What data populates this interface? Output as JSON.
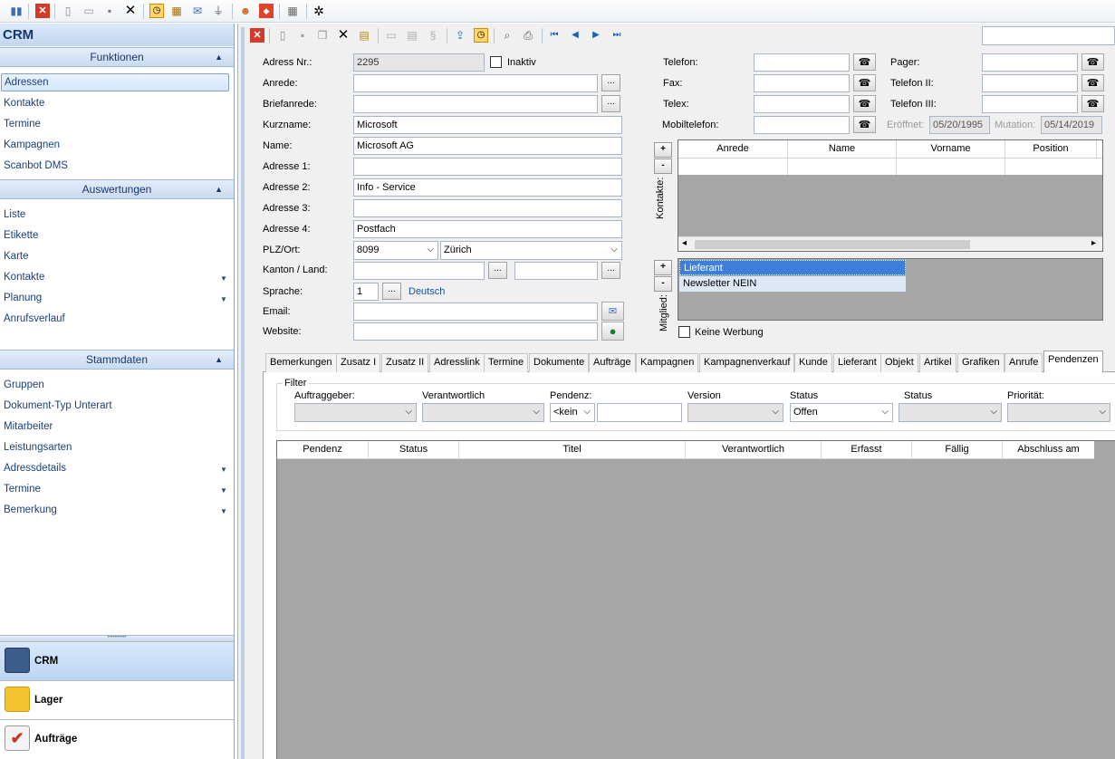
{
  "app_title": "CRM",
  "sidebar": {
    "funktionen_header": "Funktionen",
    "funktionen_items": [
      "Adressen",
      "Kontakte",
      "Termine",
      "Kampagnen",
      "Scanbot DMS"
    ],
    "auswertungen_header": "Auswertungen",
    "auswertungen_items": [
      "Liste",
      "Etikette",
      "Karte",
      "Kontakte",
      "Planung",
      "Anrufsverlauf"
    ],
    "stammdaten_header": "Stammdaten",
    "stammdaten_items": [
      "Gruppen",
      "Dokument-Typ Unterart",
      "Mitarbeiter",
      "Leistungsarten",
      "Adressdetails",
      "Termine",
      "Bemerkung"
    ],
    "modules": [
      "CRM",
      "Lager",
      "Aufträge"
    ]
  },
  "form": {
    "adress_nr_label": "Adress Nr.:",
    "adress_nr": "2295",
    "inaktiv_label": "Inaktiv",
    "anrede_label": "Anrede:",
    "briefanrede_label": "Briefanrede:",
    "kurzname_label": "Kurzname:",
    "kurzname": "Microsoft",
    "name_label": "Name:",
    "name": "Microsoft AG",
    "adresse1_label": "Adresse 1:",
    "adresse2_label": "Adresse 2:",
    "adresse2": "Info - Service",
    "adresse3_label": "Adresse 3:",
    "adresse4_label": "Adresse 4:",
    "adresse4": "Postfach",
    "plz_label": "PLZ/Ort:",
    "plz": "8099",
    "ort": "Zürich",
    "kanton_label": "Kanton / Land:",
    "sprache_label": "Sprache:",
    "sprache_code": "1",
    "sprache_name": "Deutsch",
    "email_label": "Email:",
    "website_label": "Website:",
    "telefon_label": "Telefon:",
    "fax_label": "Fax:",
    "telex_label": "Telex:",
    "mobil_label": "Mobiltelefon:",
    "pager_label": "Pager:",
    "telefon2_label": "Telefon II:",
    "telefon3_label": "Telefon III:",
    "eroeffnet_label": "Eröffnet:",
    "eroeffnet": "05/20/1995",
    "mutation_label": "Mutation:",
    "mutation": "05/14/2019",
    "kontakte_side_label": "Kontakte:",
    "mitglied_side_label": "Mitglied:",
    "keine_werbung_label": "Keine Werbung",
    "plus": "+",
    "minus": "-",
    "dots": "..."
  },
  "contacts_table": {
    "columns": [
      "Anrede",
      "Name",
      "Vorname",
      "Position"
    ]
  },
  "mitglied_list": [
    "Lieferant",
    "Newsletter NEIN"
  ],
  "tabs": [
    "Bemerkungen",
    "Zusatz I",
    "Zusatz II",
    "Adresslink",
    "Termine",
    "Dokumente",
    "Aufträge",
    "Kampagnen",
    "Kampagnenverkauf",
    "Kunde",
    "Lieferant",
    "Objekt",
    "Artikel",
    "Grafiken",
    "Anrufe",
    "Pendenzen"
  ],
  "active_tab": "Pendenzen",
  "filter": {
    "group_label": "Filter",
    "labels": [
      "Auftraggeber:",
      "Verantwortlich",
      "Pendenz:",
      "Version",
      "Status",
      "Status",
      "Priorität:"
    ],
    "pendenz_value": "<kein",
    "status_value": "Offen"
  },
  "pendenzen_table": {
    "columns": [
      "Pendenz",
      "Status",
      "Titel",
      "Verantwortlich",
      "Erfasst",
      "Fällig",
      "Abschluss am"
    ]
  },
  "colors": {
    "sidebar_text": "#1a3f79",
    "header_gradient_top": "#e4eefb",
    "grid_gray": "#a6a6a6",
    "selection_blue": "#3d7fd9"
  }
}
